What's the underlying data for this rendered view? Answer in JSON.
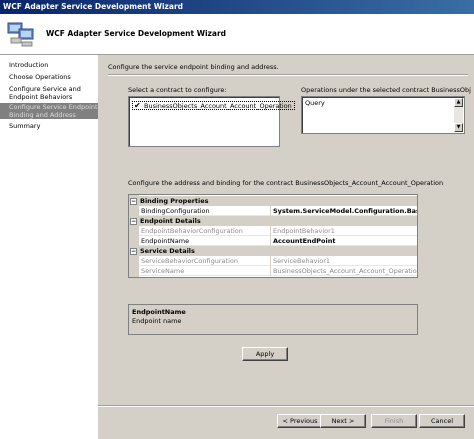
{
  "window": {
    "title": "WCF Adapter Service Development Wizard"
  },
  "header": {
    "title": "WCF Adapter Service Development Wizard",
    "icon": "computer-network-icon"
  },
  "nav": {
    "items": [
      {
        "label": "Introduction"
      },
      {
        "label": "Choose Operations"
      },
      {
        "label": "Configure Service and"
      },
      {
        "label": "Endpoint Behaviors"
      },
      {
        "label": "Configure Service Endpoint"
      },
      {
        "label": "Binding and Address"
      },
      {
        "label": "Summary"
      }
    ]
  },
  "main": {
    "instruction": "Configure the service endpoint binding and address.",
    "contract_label": "Select a contract to configure:",
    "contract_item": "BusinessObjects_Account_Account_Operation",
    "operations_label": "Operations under the selected contract  BusinessObjects_Accou",
    "operations": [
      "Query"
    ],
    "configure_label": "Configure the address and binding for the contract  BusinessObjects_Account_Account_Operation",
    "grid": {
      "binding_properties": {
        "category": "Binding Properties",
        "rows": [
          {
            "name": "BindingConfiguration",
            "value": "System.ServiceModel.Configuration.BasicHt"
          }
        ]
      },
      "endpoint_details": {
        "category": "Endpoint Details",
        "rows": [
          {
            "name": "EndpointBehaviorConfiguration",
            "value": "EndpointBehavior1"
          },
          {
            "name": "EndpointName",
            "value": "AccountEndPoint"
          }
        ]
      },
      "service_details": {
        "category": "Service Details",
        "rows": [
          {
            "name": "ServiceBehaviorConfiguration",
            "value": "ServiceBehavior1"
          },
          {
            "name": "ServiceName",
            "value": "BusinessObjects_Account_Account_OperationClient"
          }
        ]
      }
    },
    "description": {
      "title": "EndpointName",
      "text": "Endpoint name"
    },
    "apply_label": "Apply"
  },
  "buttons": {
    "previous": "< Previous",
    "next": "Next >",
    "finish": "Finish",
    "cancel": "Cancel"
  }
}
